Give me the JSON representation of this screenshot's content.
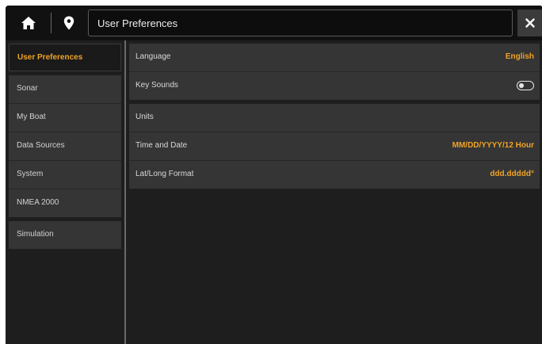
{
  "topbar": {
    "home_icon": "home-icon",
    "waypoint_icon": "map-pin-icon",
    "title": "User Preferences",
    "close_icon": "close-icon"
  },
  "sidebar": {
    "items": [
      {
        "label": "User Preferences",
        "selected": true
      },
      {
        "label": "Sonar",
        "selected": false
      },
      {
        "label": "My Boat",
        "selected": false
      },
      {
        "label": "Data Sources",
        "selected": false
      },
      {
        "label": "System",
        "selected": false
      },
      {
        "label": "NMEA 2000",
        "selected": false
      },
      {
        "label": "Simulation",
        "selected": false
      }
    ]
  },
  "settings": {
    "language": {
      "label": "Language",
      "value": "English"
    },
    "key_sounds": {
      "label": "Key Sounds",
      "enabled": false
    },
    "units": {
      "label": "Units"
    },
    "time_date": {
      "label": "Time and Date",
      "value": "MM/DD/YYYY/12 Hour"
    },
    "latlong": {
      "label": "Lat/Long Format",
      "value": "ddd.ddddd°"
    }
  },
  "colors": {
    "accent": "#f0a326",
    "background": "#1e1e1e",
    "panel": "#353535",
    "topbar": "#111111"
  }
}
